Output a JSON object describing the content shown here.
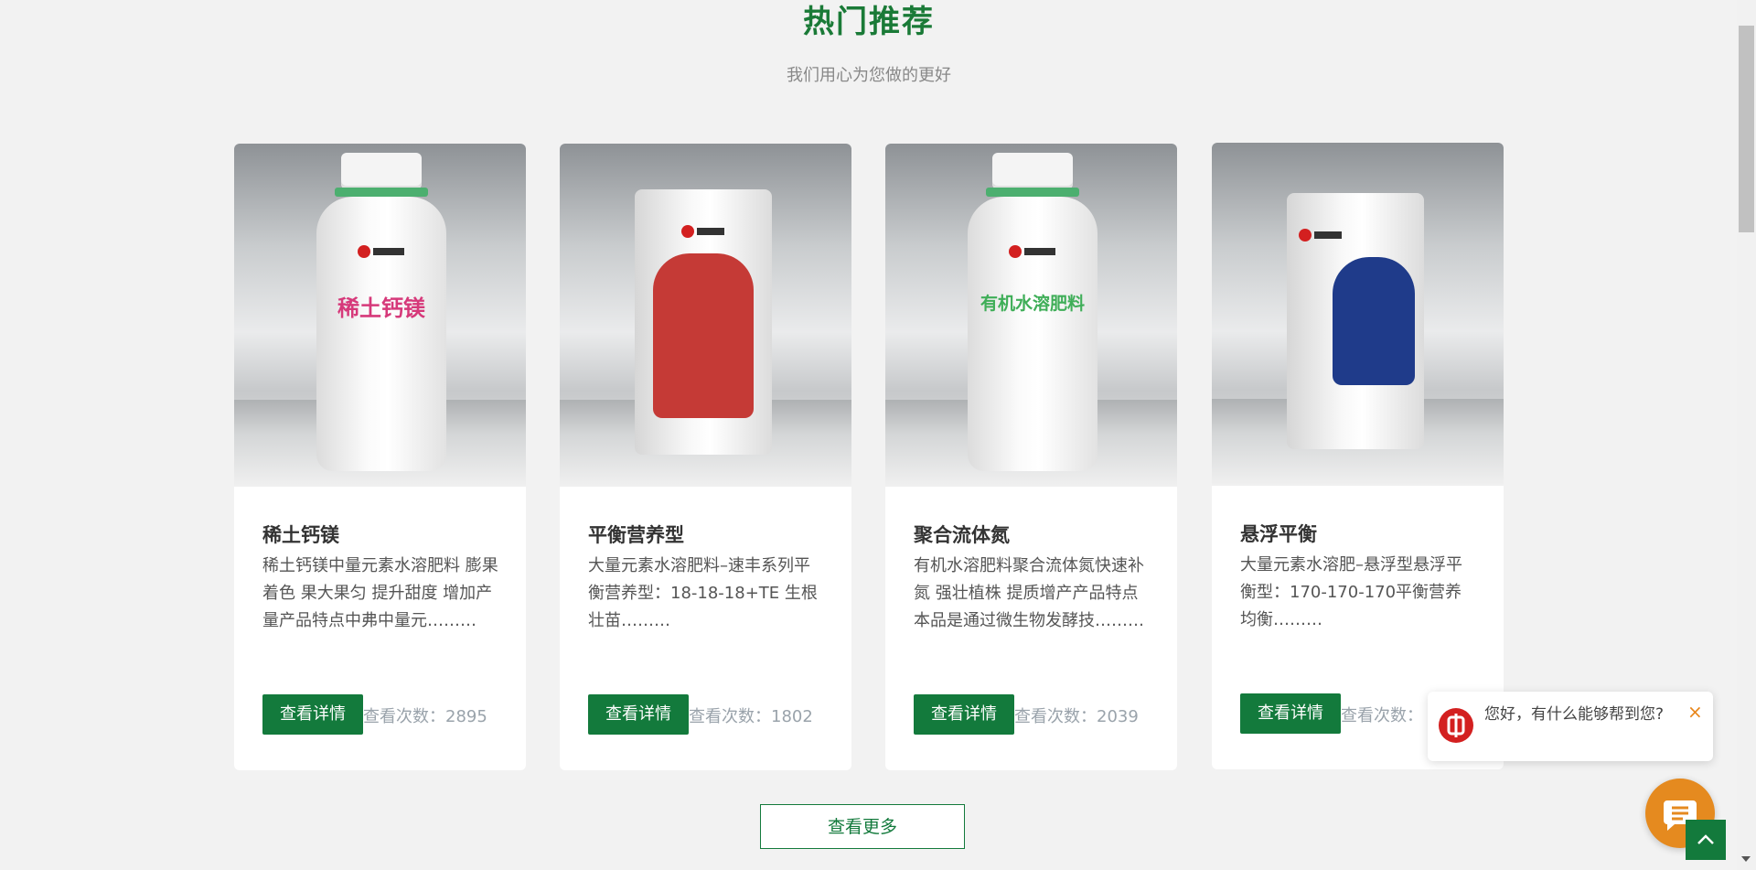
{
  "section": {
    "title": "热门推荐",
    "subtitle": "我们用心为您做的更好"
  },
  "products": [
    {
      "name": "稀土钙镁",
      "desc": "稀土钙镁中量元素水溶肥料 膨果着色 果大果匀 提升甜度 增加产量产品特点中弗中量元………",
      "button": "查看详情",
      "views_label": "查看次数：",
      "views": "2895",
      "pack": "bottle",
      "pack_text": "稀土钙镁",
      "accent": "#d6397a"
    },
    {
      "name": "平衡营养型",
      "desc": "大量元素水溶肥料–速丰系列平衡营养型：18-18-18+TE 生根壮苗………",
      "button": "查看详情",
      "views_label": "查看次数：",
      "views": "1802",
      "pack": "bag",
      "accent": "#c53a36"
    },
    {
      "name": "聚合流体氮",
      "desc": "有机水溶肥料聚合流体氮快速补氮 强壮植株 提质增产产品特点本品是通过微生物发酵技………",
      "button": "查看详情",
      "views_label": "查看次数：",
      "views": "2039",
      "pack": "bottle",
      "pack_text": "有机水溶肥料",
      "accent": "#3fae58"
    },
    {
      "name": "悬浮平衡",
      "desc": "大量元素水溶肥–悬浮型悬浮平衡型：170-170-170平衡营养均衡………",
      "button": "查看详情",
      "views_label": "查看次数：",
      "views": "",
      "pack": "bag",
      "accent": "#1f3b8a"
    }
  ],
  "more_button": "查看更多",
  "chat": {
    "message": "您好，有什么能够帮到您?",
    "close": "×"
  },
  "colors": {
    "brand_green": "#137a3c",
    "chat_orange": "#e58a1f"
  }
}
